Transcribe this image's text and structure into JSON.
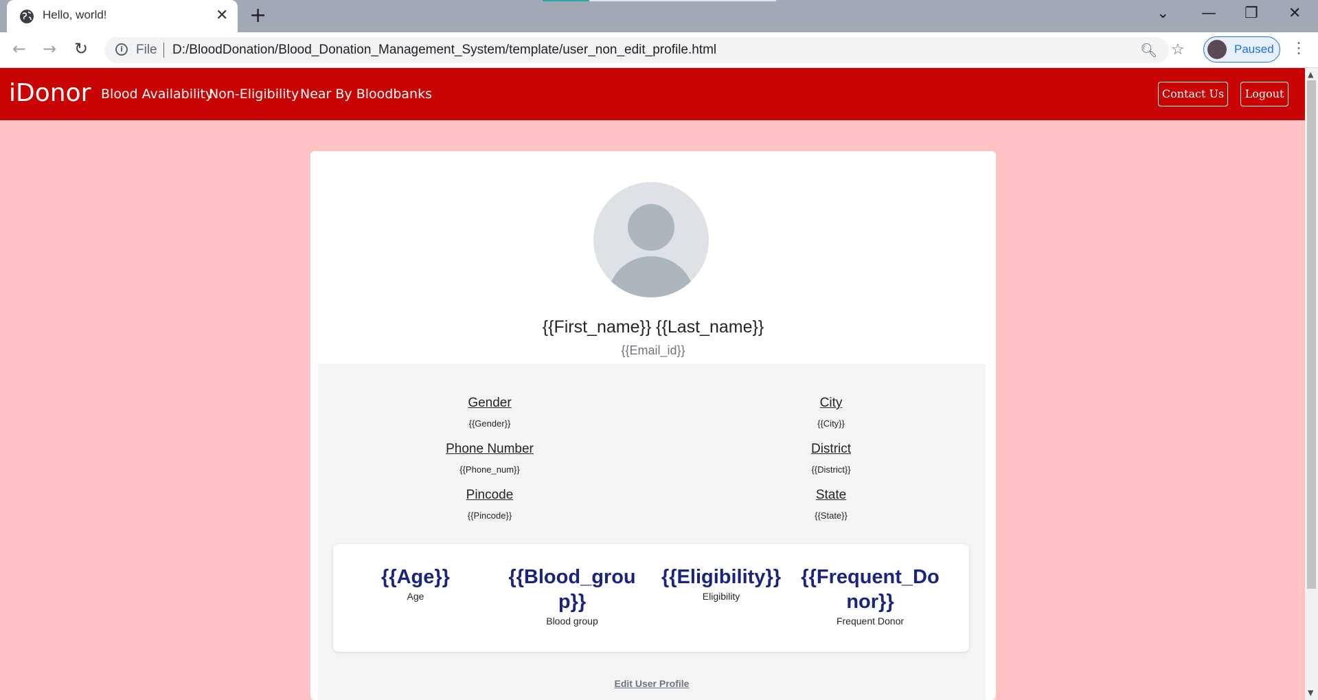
{
  "browser": {
    "tab_title": "Hello, world!",
    "omnibox_prefix": "File",
    "url": "D:/BloodDonation/Blood_Donation_Management_System/template/user_non_edit_profile.html",
    "profile_label": "Paused"
  },
  "navbar": {
    "brand": "iDonor",
    "links": [
      "Blood Availability",
      "Non-Eligibility",
      "Near By Bloodbanks"
    ],
    "contact_label": "Contact Us",
    "logout_label": "Logout",
    "color": "#c80404"
  },
  "profile": {
    "full_name": "{{First_name}} {{Last_name}}",
    "email": "{{Email_id}}",
    "fields": {
      "gender_label": "Gender",
      "gender_value": "{{Gender}}",
      "phone_label": "Phone Number",
      "phone_value": "{{Phone_num}}",
      "pincode_label": "Pincode",
      "pincode_value": "{{Pincode}}",
      "city_label": "City",
      "city_value": "{{City}}",
      "district_label": "District",
      "district_value": "{{District}}",
      "state_label": "State",
      "state_value": "{{State}}"
    },
    "stats": [
      {
        "value": "{{Age}}",
        "label": "Age"
      },
      {
        "value": "{{Blood_group}}",
        "label": "Blood group"
      },
      {
        "value": "{{Eligibility}}",
        "label": "Eligibility"
      },
      {
        "value": "{{Frequent_Donor}}",
        "label": "Frequent Donor"
      }
    ],
    "edit_label": "Edit User Profile"
  },
  "colors": {
    "page_background": "#ffc1c1",
    "stat_value": "#1a237e"
  }
}
